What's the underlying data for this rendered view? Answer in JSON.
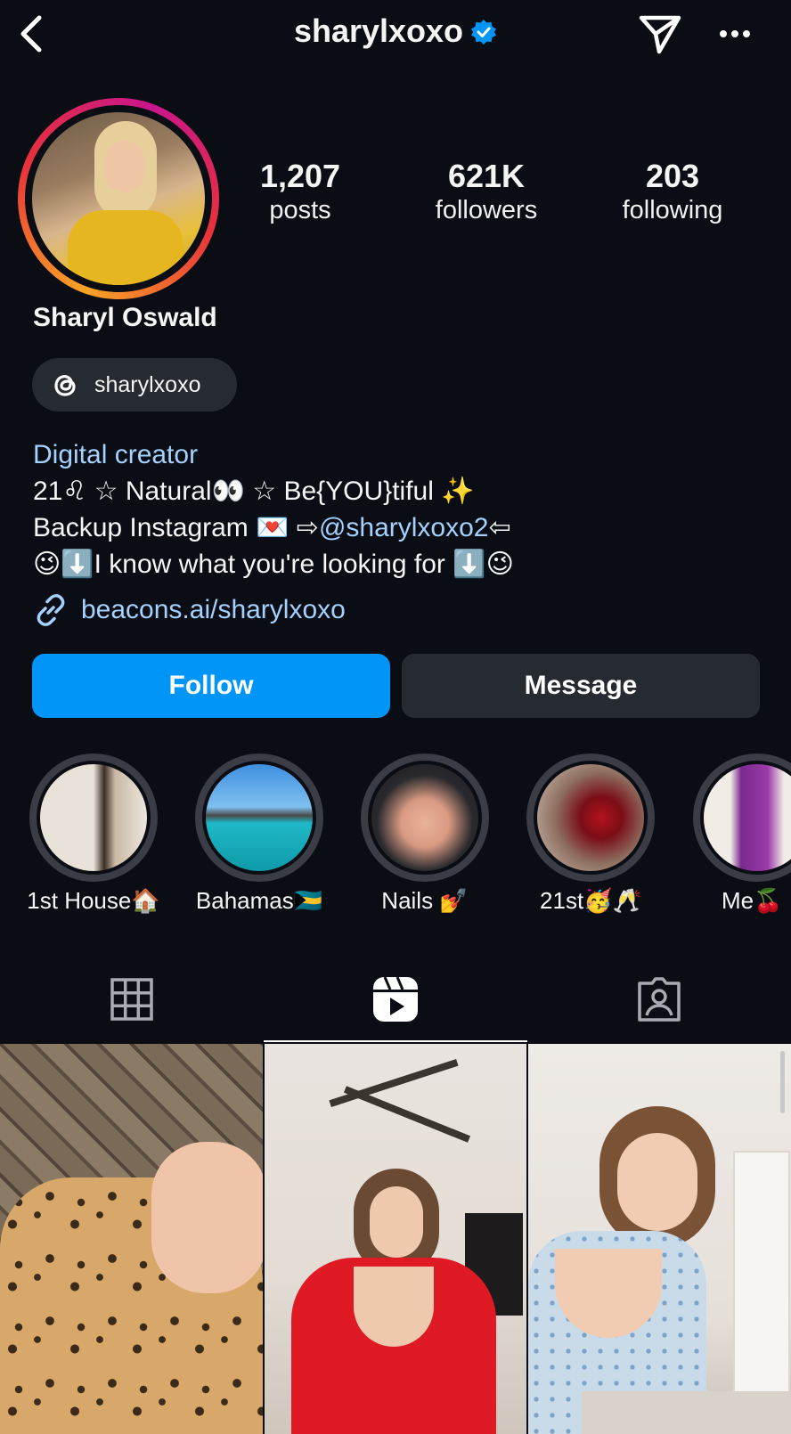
{
  "header": {
    "username": "sharylxoxo",
    "back_icon": "chevron-left-icon",
    "verified_icon": "verified-badge-icon",
    "send_icon": "paper-plane-icon",
    "more_icon": "more-horizontal-icon"
  },
  "profile": {
    "stats": [
      {
        "value": "1,207",
        "label": "posts"
      },
      {
        "value": "621K",
        "label": "followers"
      },
      {
        "value": "203",
        "label": "following"
      }
    ],
    "full_name": "Sharyl Oswald",
    "threads_handle": "sharylxoxo",
    "category": "Digital creator",
    "bio_line1": "21♌ ☆ Natural👀 ☆ Be{YOU}tiful ✨",
    "bio_line2_prefix": "Backup Instagram 💌 ⇨",
    "bio_line2_mention": "@sharylxoxo2",
    "bio_line2_suffix": "⇦",
    "bio_line3": "😉⬇️I know what you're looking for ⬇️😉",
    "link": "beacons.ai/sharylxoxo"
  },
  "actions": {
    "follow_label": "Follow",
    "message_label": "Message"
  },
  "highlights": [
    {
      "label": "1st House🏠"
    },
    {
      "label": "Bahamas🇧🇸"
    },
    {
      "label": "Nails 💅"
    },
    {
      "label": "21st🥳🥂"
    },
    {
      "label": "Me🍒"
    }
  ],
  "tabs": [
    {
      "icon": "grid-icon",
      "active": false
    },
    {
      "icon": "reels-icon",
      "active": true
    },
    {
      "icon": "tagged-icon",
      "active": false
    }
  ],
  "colors": {
    "background": "#0b0d14",
    "accent": "#0095f6",
    "link": "#a5d1ff",
    "button_secondary": "#262a31"
  }
}
